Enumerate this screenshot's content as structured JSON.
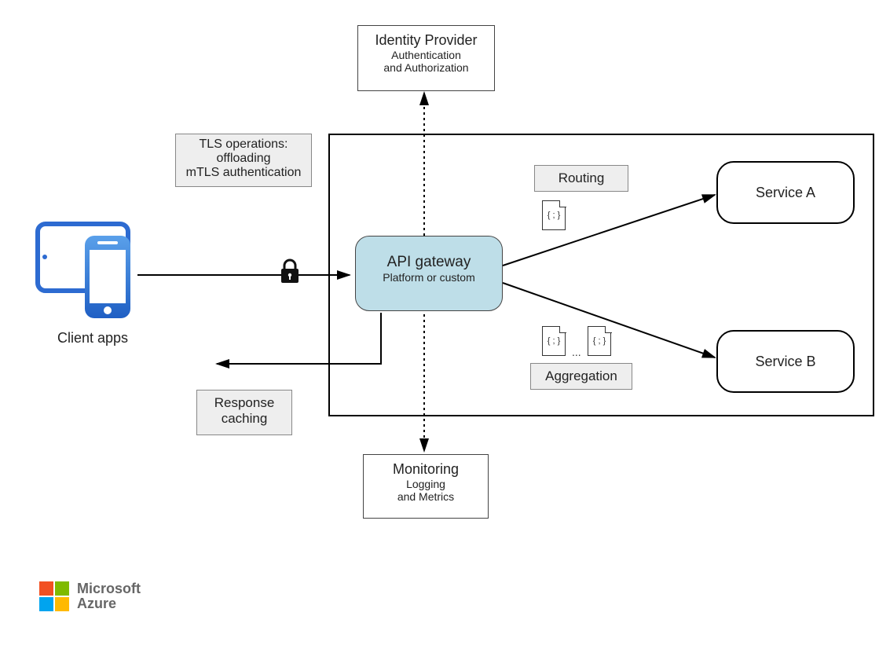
{
  "identity_provider": {
    "title": "Identity Provider",
    "line1": "Authentication",
    "line2": "and Authorization"
  },
  "tls_box": {
    "line1": "TLS operations:",
    "line2": "offloading",
    "line3": "mTLS authentication"
  },
  "routing_label": "Routing",
  "aggregation_label": "Aggregation",
  "gateway": {
    "title": "API gateway",
    "subtitle": "Platform or custom"
  },
  "service_a": "Service A",
  "service_b": "Service B",
  "response_caching": {
    "line1": "Response",
    "line2": "caching"
  },
  "monitoring": {
    "title": "Monitoring",
    "line1": "Logging",
    "line2": "and Metrics"
  },
  "client_apps_label": "Client apps",
  "logo": {
    "line1": "Microsoft",
    "line2": "Azure"
  },
  "icons": {
    "file_curly": "{ ; }",
    "dots": "..."
  }
}
